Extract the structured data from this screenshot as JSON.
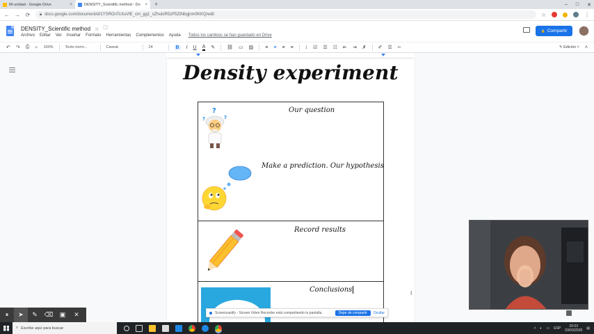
{
  "browser": {
    "tabs": [
      {
        "title": "Mi unidad - Google Drive",
        "favicon_color": "#fbbc04",
        "active": false
      },
      {
        "title": "DENSITY_Scientific method - Do",
        "favicon_color": "#4285f4",
        "active": true
      }
    ],
    "new_tab_symbol": "+",
    "tab_close_symbol": "×",
    "window_controls": [
      "–",
      "□",
      "✕"
    ],
    "url": "docs.google.com/document/d/1YSROnTcXuVlE_cm_gg1_sZhuloR5zP5ZtNbgjnm0KKQ/edit",
    "nav": {
      "back": "←",
      "forward": "→",
      "reload": "⟳"
    }
  },
  "docs": {
    "title": "DENSITY_Scientific method",
    "star_icon": "☆",
    "folder_icon": "🗀",
    "menu": [
      "Archivo",
      "Editar",
      "Ver",
      "Insertar",
      "Formato",
      "Herramientas",
      "Complementos",
      "Ayuda"
    ],
    "save_status": "Todos los cambios se han guardado en Drive",
    "share_label": "Compartir",
    "share_icon": "🔒"
  },
  "toolbar": {
    "undo": "↶",
    "redo": "↷",
    "print": "⎙",
    "paint": "⌐",
    "zoom": "100%",
    "style": "Texto norm...",
    "font": "Caveat",
    "size": "24",
    "bold": "B",
    "italic": "I",
    "underline": "U",
    "text_color": "A",
    "mode": "Edición"
  },
  "document": {
    "heading": "Density experiment",
    "table_rows": [
      {
        "label": "Our question"
      },
      {
        "label": "Make a prediction. Our hypothesis"
      },
      {
        "label": "Record results"
      },
      {
        "label": "Conclusions"
      }
    ]
  },
  "recording": {
    "message": "Screencastify - Screen Video Recorder está compartiendo tu pantalla.",
    "stop_label": "Dejar de compartir",
    "hide_label": "Ocultar"
  },
  "annotation_tools": [
    {
      "icon": "pause-icon",
      "glyph": "⏸"
    },
    {
      "icon": "cursor-icon",
      "glyph": "➤"
    },
    {
      "icon": "pen-icon",
      "glyph": "✎"
    },
    {
      "icon": "eraser-icon",
      "glyph": "⌫"
    },
    {
      "icon": "camera-icon",
      "glyph": "▣"
    },
    {
      "icon": "close-icon",
      "glyph": "✕"
    }
  ],
  "taskbar": {
    "search_placeholder": "Escribe aquí para buscar",
    "language": "ESP",
    "time": "20:03",
    "date": "03/03/2020"
  },
  "colors": {
    "accent": "#1a73e8",
    "docs_blue": "#4285f4"
  }
}
